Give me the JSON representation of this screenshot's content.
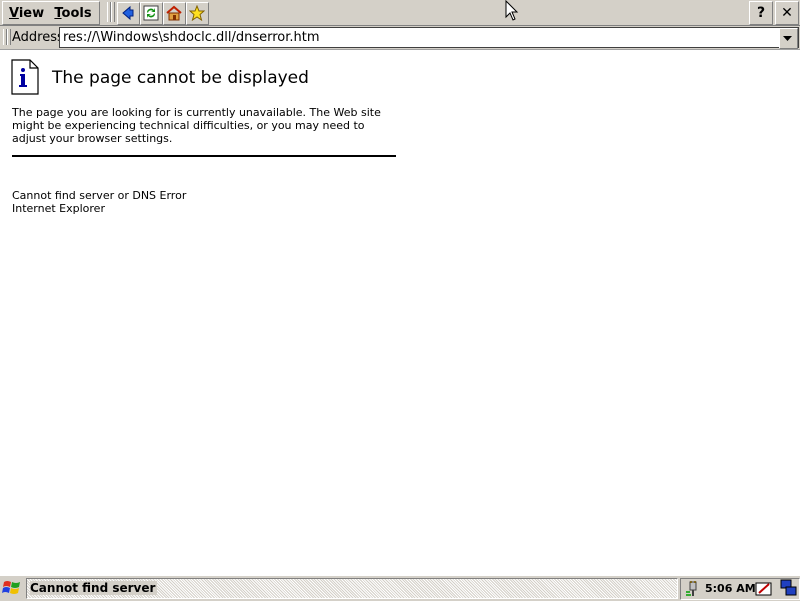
{
  "menu": {
    "view": "View",
    "tools": "Tools"
  },
  "toolbar": {
    "icons": [
      "back-icon",
      "refresh-icon",
      "home-icon",
      "favorites-icon"
    ],
    "help_label": "?",
    "close_label": "✕"
  },
  "address": {
    "label": "Address",
    "value": "res://\\Windows\\shdoclc.dll/dnserror.htm"
  },
  "page": {
    "title": "The page cannot be displayed",
    "description": "The page you are looking for is currently unavailable. The Web site might be experiencing technical difficulties, or you may need to adjust your browser settings.",
    "error_line": "Cannot find server or DNS Error",
    "browser_line": "Internet Explorer"
  },
  "taskbar": {
    "active_task": "Cannot find server",
    "clock": "5:06 AM"
  },
  "colors": {
    "chrome": "#d4d0c8",
    "accent_blue": "#0000a0"
  }
}
